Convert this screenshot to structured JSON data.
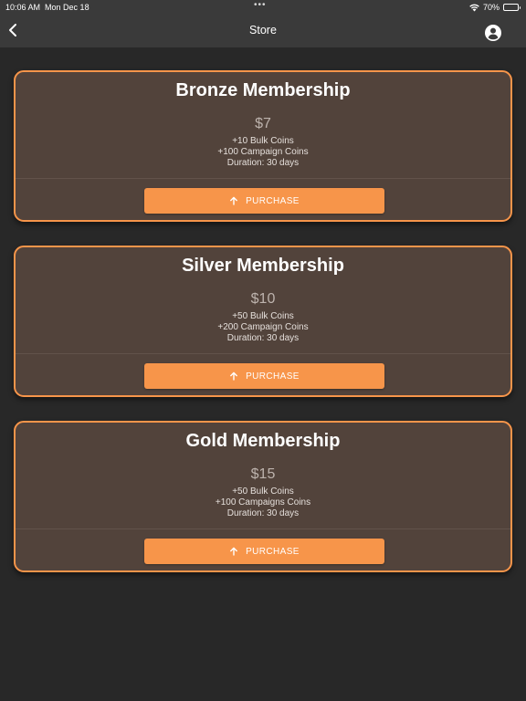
{
  "status_bar": {
    "time": "10:06 AM",
    "date": "Mon Dec 18",
    "dots": "•••",
    "battery_percent": "70%",
    "battery_level": 0.7
  },
  "nav": {
    "title": "Store",
    "back_icon": "chevron-left-icon",
    "account_icon": "account-circle-icon"
  },
  "colors": {
    "accent": "#f7954a",
    "card_bg": "#52433b",
    "page_bg": "#282828",
    "bar_bg": "#3a3a3a"
  },
  "memberships": [
    {
      "name": "Bronze Membership",
      "price": "$7",
      "bulk": "+10 Bulk Coins",
      "campaign": "+100 Campaign Coins",
      "duration": "Duration: 30 days",
      "button": "PURCHASE"
    },
    {
      "name": "Silver Membership",
      "price": "$10",
      "bulk": "+50 Bulk Coins",
      "campaign": "+200 Campaign Coins",
      "duration": "Duration: 30 days",
      "button": "PURCHASE"
    },
    {
      "name": "Gold Membership",
      "price": "$15",
      "bulk": "+50 Bulk Coins",
      "campaign": "+100  Campaigns Coins",
      "duration": "Duration: 30 days",
      "button": "PURCHASE"
    }
  ]
}
